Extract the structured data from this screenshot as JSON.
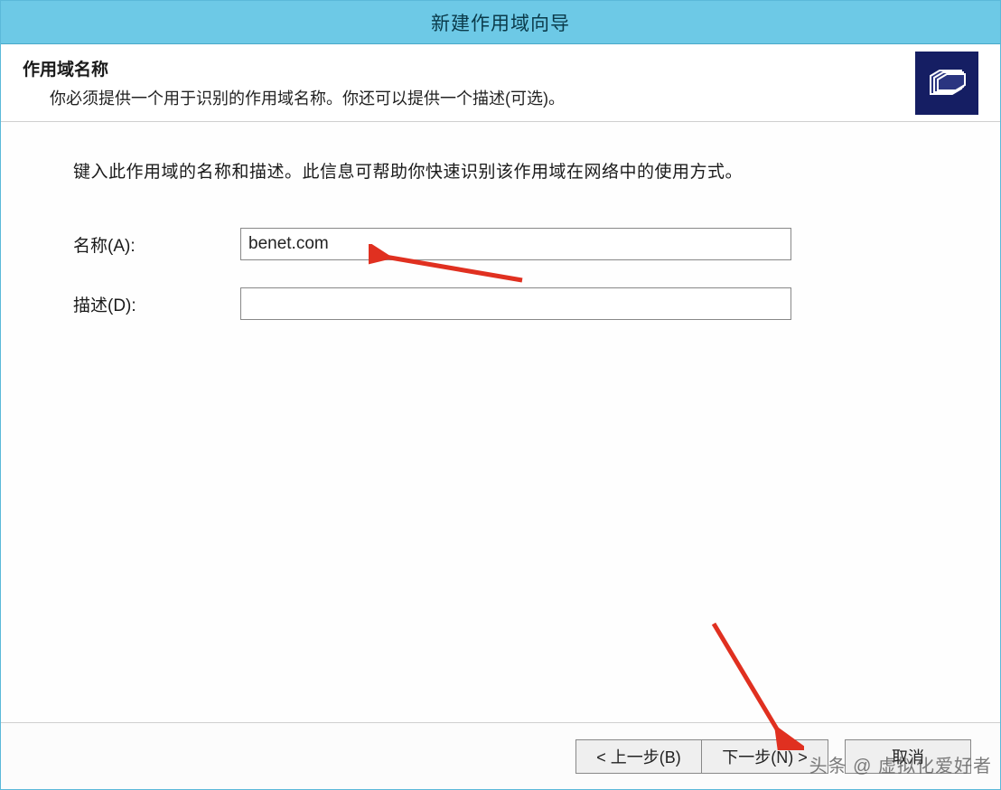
{
  "window": {
    "title": "新建作用域向导"
  },
  "header": {
    "title": "作用域名称",
    "subtitle": "你必须提供一个用于识别的作用域名称。你还可以提供一个描述(可选)。"
  },
  "body": {
    "instruction": "键入此作用域的名称和描述。此信息可帮助你快速识别该作用域在网络中的使用方式。",
    "name_label": "名称(A):",
    "name_value": "benet.com",
    "description_label": "描述(D):",
    "description_value": ""
  },
  "footer": {
    "back": "< 上一步(B)",
    "next": "下一步(N) >",
    "cancel": "取消"
  },
  "watermark": "头条 @ 虚拟化爱好者"
}
